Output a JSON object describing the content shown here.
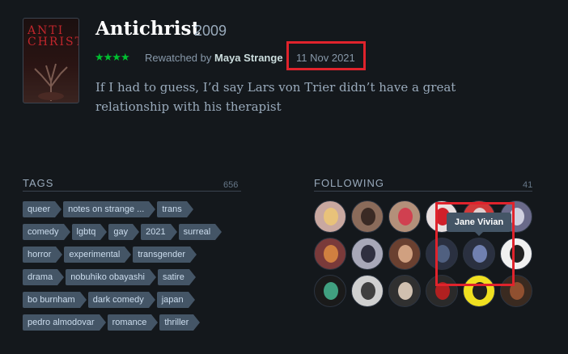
{
  "film": {
    "title": "Antichrist",
    "year": "2009",
    "poster_text": "ANTI\nCHRIST",
    "rating_stars": "★★★★",
    "rewatched_prefix": "Rewatched by",
    "user": "Maya Strange",
    "date": "11 Nov 2021",
    "review": "If I had to guess, I’d say Lars von Trier didn’t have a great relationship with his therapist"
  },
  "tags": {
    "heading": "TAGS",
    "count": "656",
    "rows": [
      [
        "queer",
        "notes on strange ...",
        "trans"
      ],
      [
        "comedy",
        "lgbtq",
        "gay",
        "2021",
        "surreal"
      ],
      [
        "horror",
        "experimental",
        "transgender"
      ],
      [
        "drama",
        "nobuhiko obayashi",
        "satire"
      ],
      [
        "bo burnham",
        "dark comedy",
        "japan"
      ],
      [
        "pedro almodovar",
        "romance",
        "thriller"
      ]
    ]
  },
  "following": {
    "heading": "FOLLOWING",
    "count": "41",
    "tooltip": "Jane Vivian",
    "avatar_colors": [
      [
        "#c9a8a0",
        "#e8c27a"
      ],
      [
        "#8a6b5a",
        "#3a2a24"
      ],
      [
        "#b3907a",
        "#d04050"
      ],
      [
        "#e8e0e0",
        "#d0202a"
      ],
      [
        "#d03a3a",
        "#e0d0d0"
      ],
      [
        "#6a6a8a",
        "#d0d0e0"
      ],
      [
        "#7a3a3a",
        "#d08040"
      ],
      [
        "#a8a8b8",
        "#303040"
      ],
      [
        "#6a4030",
        "#d0a080"
      ],
      [
        "#2a3040",
        "#506080"
      ],
      [
        "#2a3040",
        "#7080b0"
      ],
      [
        "#f0f0f0",
        "#202020"
      ],
      [
        "#1a1a1a",
        "#40a080"
      ],
      [
        "#d0d0d0",
        "#404040"
      ],
      [
        "#303030",
        "#d0c0b0"
      ],
      [
        "#2a2a2a",
        "#b02020"
      ],
      [
        "#f0e020",
        "#202020"
      ],
      [
        "#3a2a20",
        "#905030"
      ]
    ]
  }
}
